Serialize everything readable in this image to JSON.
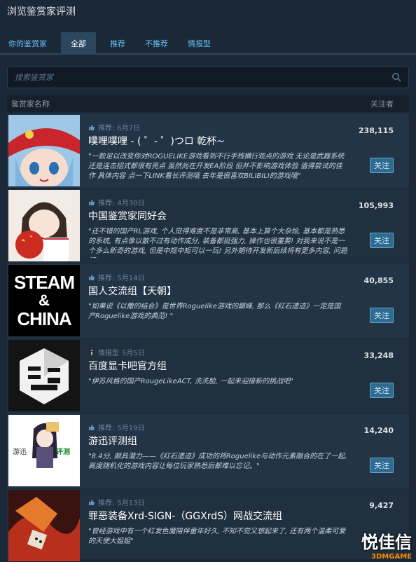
{
  "title": "浏览鉴赏家评测",
  "tabs": [
    {
      "label": "你的鉴赏家"
    },
    {
      "label": "全部"
    },
    {
      "label": "推荐"
    },
    {
      "label": "不推荐"
    },
    {
      "label": "情报型"
    }
  ],
  "search": {
    "placeholder": "搜索鉴赏家"
  },
  "header": {
    "name_col": "鉴赏家名称",
    "followers_col": "关注者"
  },
  "curators": [
    {
      "rec_type": "推荐:",
      "date": "6月7日",
      "name": "噗哩噗哩 - ( ゜- ゜)つロ 乾杯~",
      "desc": "\"一款足以改变你对ROGUELIKE游戏看到不行手残横行观点的游戏 无论是武器系统还是连击招式都很有亮点 虽然尚在开发EA阶段 但并不影响游戏体验 值得尝试的佳作 具体内容 点一下LINK看长评测哦 去年是很喜欢BILIBILI的游戏哦\"",
      "followers": "238,115",
      "button": "关注",
      "rec_icon": "thumbs-up-icon"
    },
    {
      "rec_type": "推荐:",
      "date": "4月30日",
      "name": "中国鉴赏家同好会",
      "desc": "\"还不错的国产RL游戏, 个人觉得难度不是非常高, 基本上算个大杂烩, 基本都是熟悉的系统, 有点像以散不过有动作成分, 装备都挺强力, 操作也很重要! 对我来说不是一个多么新奇的游戏, 但是中规中矩可以一玩! 另外期待开发新后续将有更多内容, 问题都\"",
      "followers": "105,993",
      "button": "关注",
      "rec_icon": "thumbs-up-icon"
    },
    {
      "rec_type": "推荐:",
      "date": "5月14日",
      "name": "国人交流组【天朝】",
      "desc": "\"如果说《以撒的结合》是世界Roguelike游戏的巅峰, 那么《红石遗迹》一定是国产Roguelike游戏的典范! \"",
      "followers": "40,855",
      "button": "关注",
      "rec_icon": "thumbs-up-icon"
    },
    {
      "rec_type": "情报型",
      "date": "5月5日",
      "name": "百度显卡吧官方组",
      "desc": "\"伊苏风格的国产RougeLikeACT, 洗洗脸, 一起来迎接新的挑战吧\"",
      "followers": "33,248",
      "button": "关注",
      "rec_icon": "info-icon"
    },
    {
      "rec_type": "推荐:",
      "date": "5月19日",
      "name": "游迅评测组",
      "desc": "\"8.4分, 颇具潜力——《红石遗迹》成功的将Roguelike与动作元素融合的在了一起, 高度随机化的游戏内容让每位玩家熟悉后都难以忘记。\"",
      "followers": "14,240",
      "button": "关注",
      "rec_icon": "thumbs-up-icon"
    },
    {
      "rec_type": "推荐:",
      "date": "5月13日",
      "name": "罪恶装备Xrd-SIGN-（GGXrdS）网战交流组",
      "desc": "\"曾经游戏中有一个红发色魔陪伴童年好久, 不知不觉又想起来了, 还有两个温柔可爱的天使大姐姐\"",
      "followers": "9,427",
      "button": "",
      "rec_icon": "thumbs-up-icon"
    }
  ],
  "avatars": {
    "steam_china": {
      "line1": "STEAM",
      "line2": "&",
      "line3": "CHINA"
    },
    "youxun": {
      "left": "游迅",
      "right": "评测"
    }
  },
  "watermark": {
    "big": "悦佳信",
    "small": "3DMGAME"
  }
}
